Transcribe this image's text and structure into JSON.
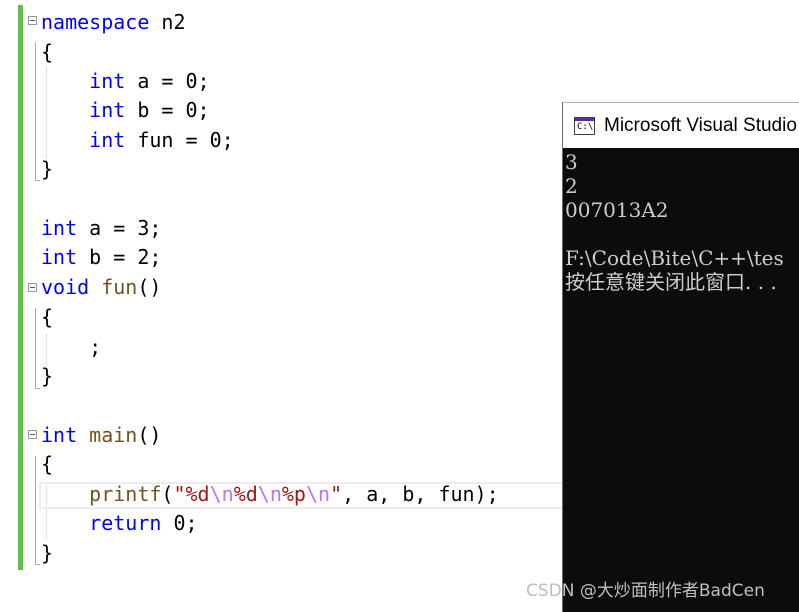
{
  "editor": {
    "namespace_keyword": "namespace",
    "namespace_name": "n2",
    "lines": {
      "ns_open": "{",
      "ns_a_type": "int",
      "ns_a_rest": " a = 0;",
      "ns_b_type": "int",
      "ns_b_rest": " b = 0;",
      "ns_fun_type": "int",
      "ns_fun_rest": " fun = 0;",
      "ns_close": "}",
      "g_a_type": "int",
      "g_a_rest": " a = 3;",
      "g_b_type": "int",
      "g_b_rest": " b = 2;",
      "fun_type": "void",
      "fun_name": "fun",
      "fun_parens": "()",
      "fun_open": "{",
      "fun_body": ";",
      "fun_close": "}",
      "main_type": "int",
      "main_name": "main",
      "main_parens": "()",
      "main_open": "{",
      "printf_name": "printf",
      "printf_lparen": "(",
      "str_q1": "\"",
      "str_f1": "%d",
      "str_e1": "\\n",
      "str_f2": "%d",
      "str_e2": "\\n",
      "str_f3": "%p",
      "str_e3": "\\n",
      "str_q2": "\"",
      "printf_args": ", a, b, fun);",
      "return_kw": "return",
      "return_rest": " 0;",
      "main_close": "}"
    }
  },
  "console": {
    "title": "Microsoft Visual Studio",
    "icon_text": "C:\\",
    "output": [
      "3",
      "2",
      "007013A2",
      "",
      "F:\\Code\\Bite\\C++\\tes",
      "按任意键关闭此窗口. . ."
    ]
  },
  "watermark": "CSDN @大炒面制作者BadCen",
  "colors": {
    "keyword": "#0000ff",
    "function": "#74531f",
    "string": "#a31515",
    "escape": "#b776fb",
    "change_bar": "#57c542",
    "console_bg": "#0c0c0c",
    "console_text": "#cccccc"
  }
}
